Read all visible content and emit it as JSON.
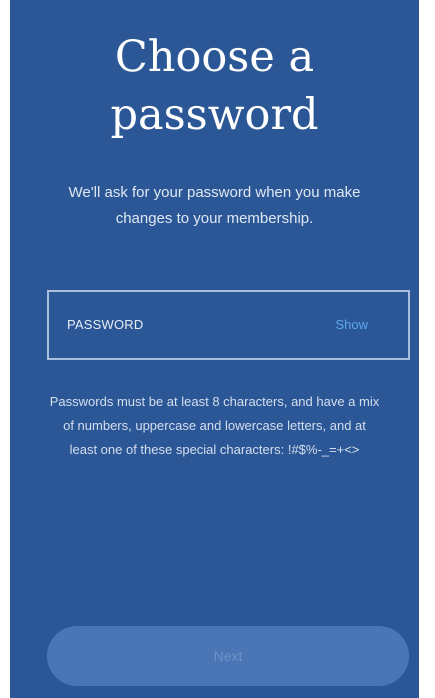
{
  "header": {
    "title": "Choose a password",
    "subtitle": "We'll ask for your password when you make changes to your membership."
  },
  "password_field": {
    "label": "PASSWORD",
    "show_label": "Show"
  },
  "hint": "Passwords must be at least 8 characters, and have a mix of numbers, uppercase and lowercase letters, and at least one of these special characters: !#$%-_=+<>",
  "footer": {
    "next_label": "Next"
  },
  "colors": {
    "background": "#2b5797",
    "link": "#5aa8f0",
    "button_disabled": "#4a76b6"
  }
}
